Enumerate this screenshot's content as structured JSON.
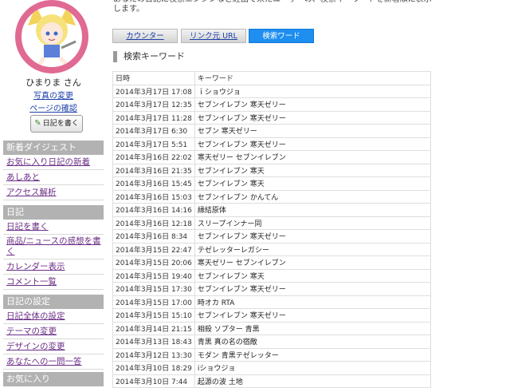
{
  "intro_text": "あなたの日記に検索エンジンなど経由で来たユーザーの、検索キーワードを新着順に表示します。",
  "profile": {
    "user_name": "ひまりま さん",
    "photo_link": "写真の変更",
    "page_link": "ページの確認",
    "write_button": "日記を書く"
  },
  "sidebar": {
    "digest": {
      "title": "新着ダイジェスト",
      "items": [
        "お気に入り日記の新着",
        "あしあと",
        "アクセス解析"
      ]
    },
    "diary": {
      "title": "日記",
      "items": [
        "日記を書く",
        "商品/ニュースの感想を書く",
        "カレンダー表示",
        "コメント一覧"
      ]
    },
    "settings": {
      "title": "日記の設定",
      "items": [
        "日記全体の設定",
        "テーマの変更",
        "デザインの変更",
        "あなたへの一問一答"
      ]
    },
    "favorites": {
      "title": "お気に入り"
    }
  },
  "tabs": [
    {
      "label": "カウンター",
      "active": false
    },
    {
      "label": "リンク元 URL",
      "active": false
    },
    {
      "label": "検索ワード",
      "active": true
    }
  ],
  "section_title": "検索キーワード",
  "table": {
    "headers": [
      "日時",
      "キーワード"
    ],
    "rows": [
      [
        "2014年3月17日 17:08",
        "ｉショウジョ"
      ],
      [
        "2014年3月17日 12:35",
        "セブンイレブン 寒天ゼリー"
      ],
      [
        "2014年3月17日 11:28",
        "セブンイレブン 寒天ゼリー"
      ],
      [
        "2014年3月17日 6:30",
        "セブン 寒天ゼリー"
      ],
      [
        "2014年3月17日 5:51",
        "セブンイレブン 寒天ゼリー"
      ],
      [
        "2014年3月16日 22:02",
        "寒天ゼリー セブンイレブン"
      ],
      [
        "2014年3月16日 21:35",
        "セブンイレブン 寒天"
      ],
      [
        "2014年3月16日 15:45",
        "セブンイレブン 寒天"
      ],
      [
        "2014年3月16日 15:03",
        "セブンイレブン かんてん"
      ],
      [
        "2014年3月16日 14:16",
        "縁結原体"
      ],
      [
        "2014年3月16日 12:18",
        "スリープインナー同"
      ],
      [
        "2014年3月16日 8:34",
        "セブンイレブン 寒天ゼリー"
      ],
      [
        "2014年3月15日 22:47",
        "テゼレッターレガシー"
      ],
      [
        "2014年3月15日 20:06",
        "寒天ゼリー セブンイレブン"
      ],
      [
        "2014年3月15日 19:40",
        "セブンイレブン 寒天"
      ],
      [
        "2014年3月15日 17:30",
        "セブンイレブン 寒天ゼリー"
      ],
      [
        "2014年3月15日 17:00",
        "時オカ RTA"
      ],
      [
        "2014年3月15日 15:10",
        "セブンイレブン 寒天ゼリー"
      ],
      [
        "2014年3月14日 21:15",
        "相殺 ソプター 青黒"
      ],
      [
        "2014年3月13日 18:43",
        "青黒 真の名の宿敵"
      ],
      [
        "2014年3月12日 13:30",
        "モダン 青黒テゼレッター"
      ],
      [
        "2014年3月10日 18:29",
        "iショウジョ"
      ],
      [
        "2014年3月10日 7:44",
        "起源の波 土地"
      ]
    ]
  },
  "colors": {
    "avatar_ring": "#e06a93",
    "tab_active": "#1e8ef0",
    "sidebar_header": "#b2b2b2",
    "sidebar_link": "#6b2e86",
    "link": "#1a3ea8"
  }
}
